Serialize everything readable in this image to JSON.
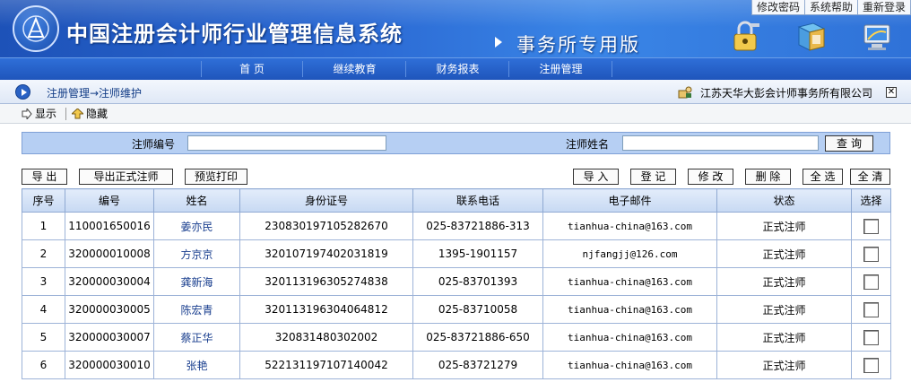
{
  "header": {
    "system_title": "中国注册会计师行业管理信息系统",
    "edition": "事务所专用版",
    "top_links": [
      "修改密码",
      "系统帮助",
      "重新登录"
    ],
    "icons": [
      "lock-key-icon",
      "help-book-icon",
      "relogin-monitor-icon"
    ]
  },
  "nav": {
    "items": [
      "首 页",
      "继续教育",
      "财务报表",
      "注册管理"
    ]
  },
  "breadcrumb": {
    "path": "注册管理→注师维护",
    "firm_name": "江苏天华大彭会计师事务所有限公司",
    "close": "✕"
  },
  "viewbar": {
    "show_label": "显示",
    "hide_label": "隐藏"
  },
  "search": {
    "cpa_no_label": "注师编号",
    "cpa_no_value": "",
    "cpa_name_label": "注师姓名",
    "cpa_name_value": "",
    "query_button": "查询"
  },
  "actions": {
    "export": "导 出",
    "export_formal": "导出正式注师",
    "preview_print": "预览打印",
    "import": "导 入",
    "register": "登 记",
    "modify": "修 改",
    "delete": "删 除",
    "select_all": "全 选",
    "clear_all": "全 清"
  },
  "table": {
    "columns": [
      "序号",
      "编号",
      "姓名",
      "身份证号",
      "联系电话",
      "电子邮件",
      "状态",
      "选择"
    ],
    "rows": [
      {
        "seq": "1",
        "no": "110001650016",
        "name": "姜亦民",
        "id": "230830197105282670",
        "phone": "025-83721886-313",
        "email": "tianhua-china@163.com",
        "status": "正式注师"
      },
      {
        "seq": "2",
        "no": "320000010008",
        "name": "方京京",
        "id": "320107197402031819",
        "phone": "1395-1901157",
        "email": "njfangjj@126.com",
        "status": "正式注师"
      },
      {
        "seq": "3",
        "no": "320000030004",
        "name": "龚新海",
        "id": "320113196305274838",
        "phone": "025-83701393",
        "email": "tianhua-china@163.com",
        "status": "正式注师"
      },
      {
        "seq": "4",
        "no": "320000030005",
        "name": "陈宏青",
        "id": "320113196304064812",
        "phone": "025-83710058",
        "email": "tianhua-china@163.com",
        "status": "正式注师"
      },
      {
        "seq": "5",
        "no": "320000030007",
        "name": "蔡正华",
        "id": "320831480302002",
        "phone": "025-83721886-650",
        "email": "tianhua-china@163.com",
        "status": "正式注师"
      },
      {
        "seq": "6",
        "no": "320000030010",
        "name": "张艳",
        "id": "522131197107140042",
        "phone": "025-83721279",
        "email": "tianhua-china@163.com",
        "status": "正式注师"
      }
    ]
  },
  "colors": {
    "banner": "#2b6ad4",
    "navbar": "#1f55bb",
    "search_bg": "#b6cff3",
    "header_cell": "#c7d9f3",
    "name_link": "#1a3f8f"
  }
}
